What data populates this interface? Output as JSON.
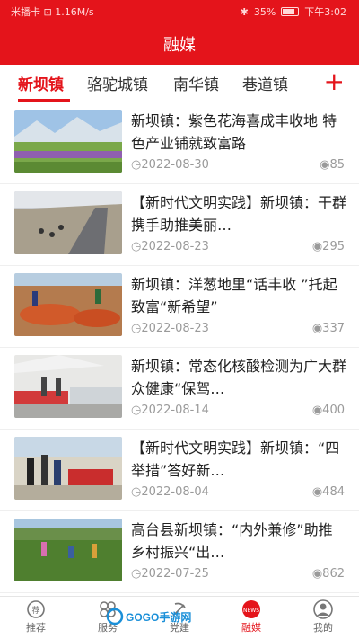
{
  "status_bar": {
    "left": "米播卡 ⊡ 1.16M/s",
    "battery": "35%",
    "time": "下午3:02"
  },
  "header": {
    "title": "融媒"
  },
  "tabs": [
    {
      "label": "新坝镇",
      "active": true
    },
    {
      "label": "骆驼城镇",
      "active": false
    },
    {
      "label": "南华镇",
      "active": false
    },
    {
      "label": "巷道镇",
      "active": false
    }
  ],
  "articles": [
    {
      "title": "新坝镇：紫色花海喜成丰收地 特色产业铺就致富路",
      "date": "2022-08-30",
      "views": "85",
      "thumb": "field-landscape"
    },
    {
      "title": "【新时代文明实践】新坝镇：干群携手助推美丽…",
      "date": "2022-08-23",
      "views": "295",
      "thumb": "roadside-work"
    },
    {
      "title": "新坝镇：洋葱地里“话丰收 ”托起致富“新希望”",
      "date": "2022-08-23",
      "views": "337",
      "thumb": "onion-harvest"
    },
    {
      "title": "新坝镇：常态化核酸检测为广大群众健康“保驾…",
      "date": "2022-08-14",
      "views": "400",
      "thumb": "testing-station"
    },
    {
      "title": "【新时代文明实践】新坝镇：“四举措”答好新…",
      "date": "2022-08-04",
      "views": "484",
      "thumb": "outdoor-meeting"
    },
    {
      "title": "高台县新坝镇：“内外兼修”助推乡村振兴“出…",
      "date": "2022-07-25",
      "views": "862",
      "thumb": "farm-workers"
    }
  ],
  "bottom_nav": [
    {
      "label": "推荐",
      "icon": "recommend-icon",
      "active": false
    },
    {
      "label": "服务",
      "icon": "service-icon",
      "active": false
    },
    {
      "label": "党建",
      "icon": "party-building-icon",
      "active": false
    },
    {
      "label": "融媒",
      "icon": "news-globe-icon",
      "active": true
    },
    {
      "label": "我的",
      "icon": "profile-icon",
      "active": false
    }
  ],
  "watermark": "GOGO手游网",
  "colors": {
    "brand": "#e4141b",
    "text": "#222222",
    "meta": "#9a9a9a"
  }
}
